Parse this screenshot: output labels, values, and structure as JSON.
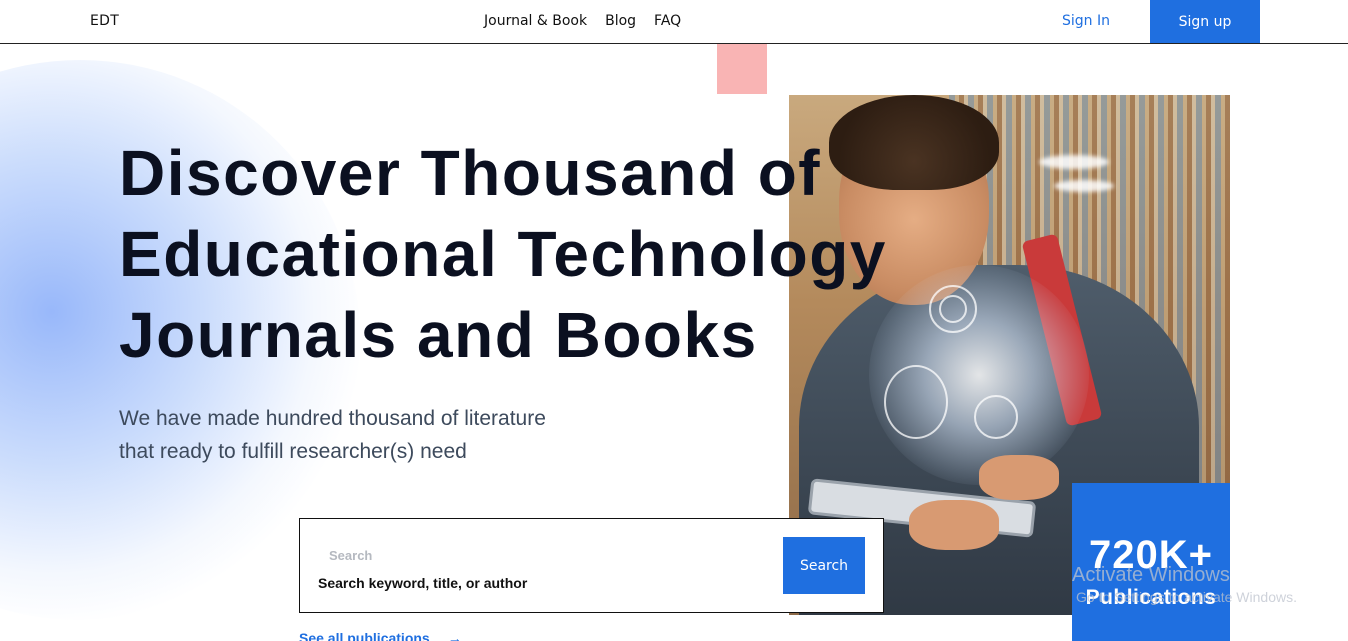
{
  "header": {
    "logo": "EDT",
    "nav": [
      "Journal & Book",
      "Blog",
      "FAQ"
    ],
    "sign_in": "Sign In",
    "sign_up": "Sign up"
  },
  "hero": {
    "headline": [
      "Discover Thousand of",
      "Educational Technology",
      "Journals and Books"
    ],
    "subtext": [
      "We have made hundred thousand of literature",
      "that ready to fulfill researcher(s) need"
    ]
  },
  "search": {
    "label": "Search",
    "placeholder": "Search keyword, title, or author",
    "button": "Search"
  },
  "see_all": "See all publications",
  "stats": {
    "value": "720K+",
    "label": "Publications"
  },
  "watermark": {
    "title": "Activate Windows",
    "subtitle": "Go to Settings to activate Windows."
  },
  "colors": {
    "accent": "#1f6fe0",
    "pink_square": "#f9b4b4",
    "headline": "#0b1020"
  }
}
